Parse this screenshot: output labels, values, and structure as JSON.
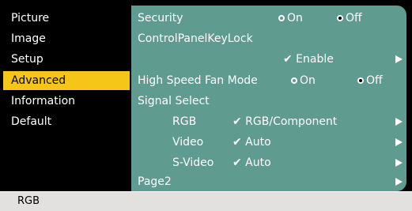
{
  "sidebar": {
    "items": [
      {
        "label": "Picture"
      },
      {
        "label": "Image"
      },
      {
        "label": "Setup"
      },
      {
        "label": "Advanced"
      },
      {
        "label": "Information"
      },
      {
        "label": "Default"
      }
    ],
    "active_index": 3
  },
  "content": {
    "security": {
      "label": "Security",
      "on": "On",
      "off": "Off",
      "selected": "Off"
    },
    "control_panel": {
      "label": "ControlPanelKeyLock",
      "check": "✔ Enable"
    },
    "fan": {
      "label": "High Speed Fan Mode",
      "on": "On",
      "off": "Off",
      "selected": "Off"
    },
    "signal_select": {
      "label": "Signal Select",
      "rows": [
        {
          "name": "RGB",
          "value": "✔ RGB/Component"
        },
        {
          "name": "Video",
          "value": "✔ Auto"
        },
        {
          "name": "S-Video",
          "value": "✔ Auto"
        }
      ]
    },
    "page2": {
      "label": "Page2"
    }
  },
  "status": {
    "text": "RGB"
  },
  "colors": {
    "accent": "#f5c518",
    "panel": "#5f9b8f",
    "status_bg": "#e3e1df"
  }
}
